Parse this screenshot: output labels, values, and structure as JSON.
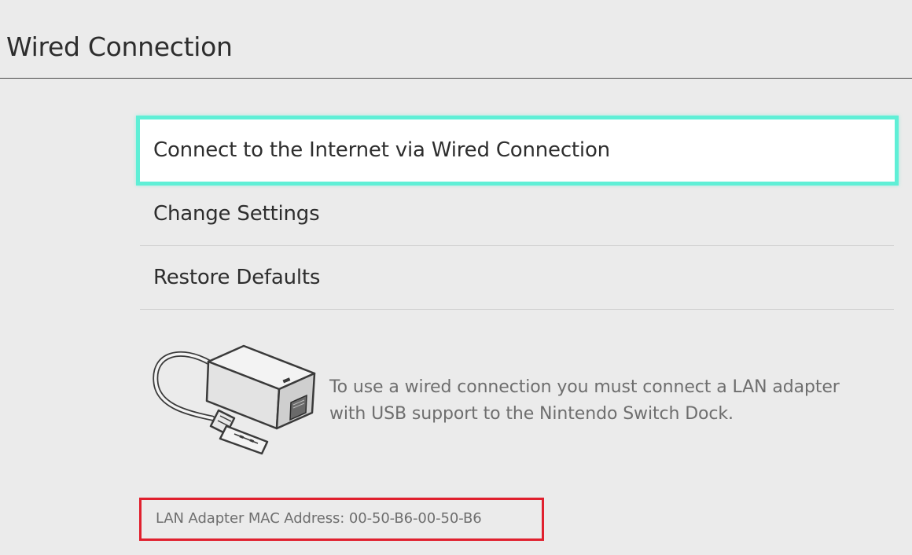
{
  "header": {
    "title": "Wired Connection"
  },
  "menu": {
    "items": [
      {
        "label": "Connect to the Internet via Wired Connection",
        "selected": true
      },
      {
        "label": "Change Settings",
        "selected": false
      },
      {
        "label": "Restore Defaults",
        "selected": false
      }
    ]
  },
  "info": {
    "illustration": "lan-adapter-icon",
    "line1": "To use a wired connection you must connect a LAN adapter",
    "line2": "with USB support to the Nintendo Switch Dock."
  },
  "mac": {
    "text": "LAN Adapter MAC Address: 00-50-B6-00-50-B6",
    "highlight_color": "#e0202e"
  },
  "colors": {
    "background": "#ebebeb",
    "selection": "#5fefd6"
  }
}
